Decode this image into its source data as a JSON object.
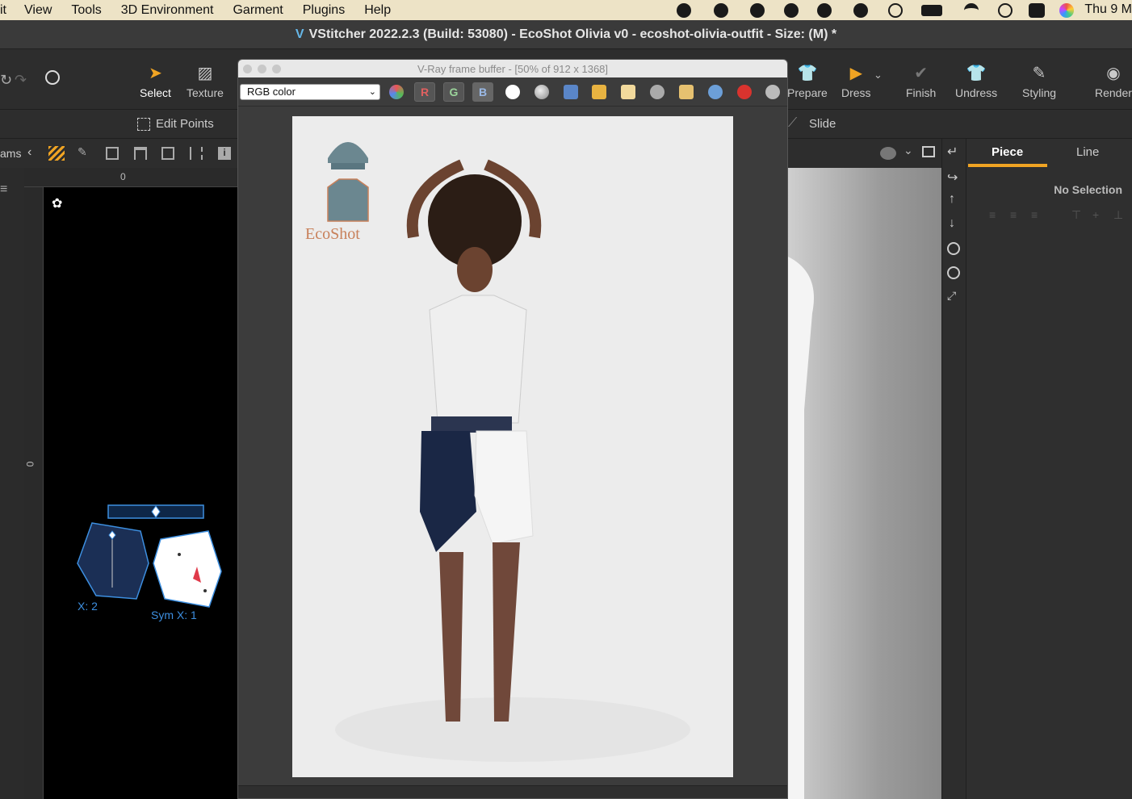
{
  "menubar": {
    "items": [
      "it",
      "View",
      "Tools",
      "3D Environment",
      "Garment",
      "Plugins",
      "Help"
    ],
    "clock": "Thu 9 M"
  },
  "window": {
    "title": "VStitcher 2022.2.3 (Build: 53080) - EcoShot Olivia v0 - ecoshot-olivia-outfit - Size: (M) *"
  },
  "toolbar": {
    "select": "Select",
    "texture": "Texture",
    "prepare": "Prepare",
    "dress": "Dress",
    "finish": "Finish",
    "undress": "Undress",
    "styling": "Styling",
    "render": "Render"
  },
  "subtoolbar": {
    "edit_points": "Edit Points",
    "slide": "Slide"
  },
  "left_panel": {
    "label": "ams",
    "ruler_zero": "0",
    "vruler_zero": "0",
    "piece_label_1": "X: 2",
    "piece_label_2": "Sym X: 1"
  },
  "vfb": {
    "title": "V-Ray frame buffer - [50% of 912 x 1368]",
    "channel": "RGB color",
    "r": "R",
    "g": "G",
    "b": "B",
    "logo_text": "EcoShot"
  },
  "right_panel": {
    "tab_piece": "Piece",
    "tab_line": "Line",
    "status": "No Selection"
  },
  "colors": {
    "accent": "#f0a423",
    "select_blue": "#3d8fe0"
  }
}
